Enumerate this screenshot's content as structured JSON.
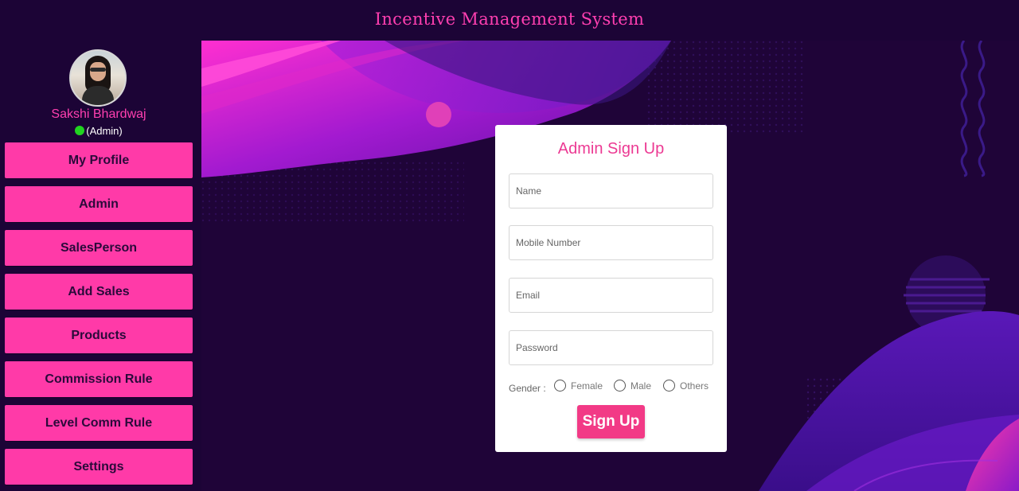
{
  "app": {
    "title": "Incentive Management System"
  },
  "user": {
    "name": "Sakshi Bhardwaj",
    "role": "(Admin)",
    "status_color": "#21d321"
  },
  "sidebar": {
    "items": [
      {
        "label": "My Profile"
      },
      {
        "label": "Admin"
      },
      {
        "label": "SalesPerson"
      },
      {
        "label": "Add Sales"
      },
      {
        "label": "Products"
      },
      {
        "label": "Commission Rule"
      },
      {
        "label": "Level Comm Rule"
      },
      {
        "label": "Settings"
      }
    ]
  },
  "form": {
    "title": "Admin Sign Up",
    "name_placeholder": "Name",
    "mobile_placeholder": "Mobile Number",
    "email_placeholder": "Email",
    "password_placeholder": "Password",
    "gender_label": "Gender :",
    "gender_options": [
      "Female",
      "Male",
      "Others"
    ],
    "submit_label": "Sign Up"
  },
  "colors": {
    "accent": "#ff3aa8",
    "background": "#1c0436",
    "button": "#f23a86"
  }
}
